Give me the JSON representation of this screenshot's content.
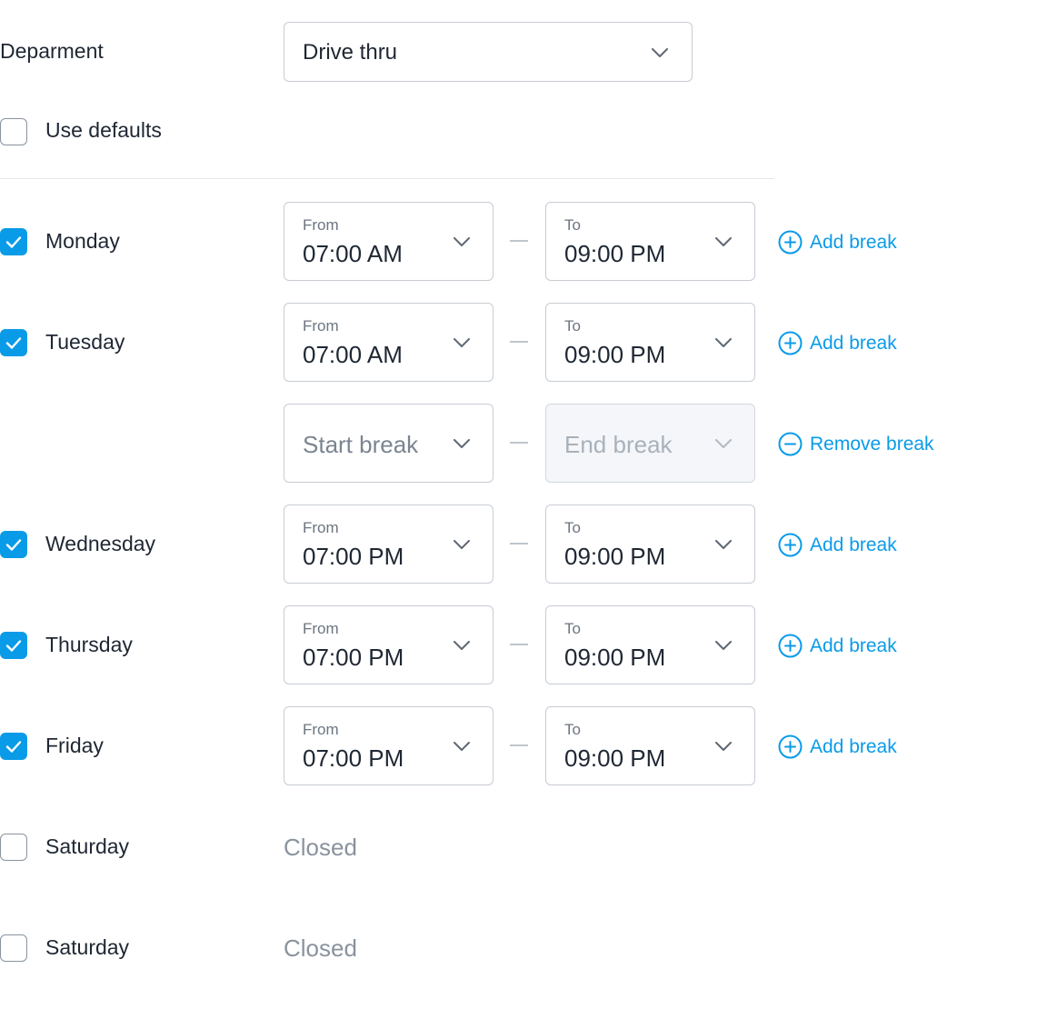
{
  "department": {
    "label": "Deparment",
    "value": "Drive thru"
  },
  "use_defaults": {
    "label": "Use defaults",
    "checked": false
  },
  "days": [
    {
      "name": "Monday",
      "checked": true,
      "from_caption": "From",
      "from": "07:00 AM",
      "to_caption": "To",
      "to": "09:00 PM",
      "action": "Add break"
    },
    {
      "name": "Tuesday",
      "checked": true,
      "from_caption": "From",
      "from": "07:00 AM",
      "to_caption": "To",
      "to": "09:00 PM",
      "action": "Add break"
    },
    {
      "name": "Wednesday",
      "checked": true,
      "from_caption": "From",
      "from": "07:00 PM",
      "to_caption": "To",
      "to": "09:00 PM",
      "action": "Add break"
    },
    {
      "name": "Thursday",
      "checked": true,
      "from_caption": "From",
      "from": "07:00 PM",
      "to_caption": "To",
      "to": "09:00 PM",
      "action": "Add break"
    },
    {
      "name": "Friday",
      "checked": true,
      "from_caption": "From",
      "from": "07:00 PM",
      "to_caption": "To",
      "to": "09:00 PM",
      "action": "Add break"
    },
    {
      "name": "Saturday",
      "checked": false,
      "status": "Closed"
    },
    {
      "name": "Saturday",
      "checked": false,
      "status": "Closed"
    }
  ],
  "break_row": {
    "start_placeholder": "Start break",
    "end_placeholder": "End break",
    "action": "Remove break"
  },
  "colors": {
    "accent": "#0a9be8",
    "text": "#1f2733",
    "muted": "#8a939e",
    "border": "#c7ccd3"
  },
  "icons": {
    "dropdown": "chevron-down-icon",
    "checkbox": "check-icon",
    "add": "plus-circle-icon",
    "remove": "minus-circle-icon"
  }
}
